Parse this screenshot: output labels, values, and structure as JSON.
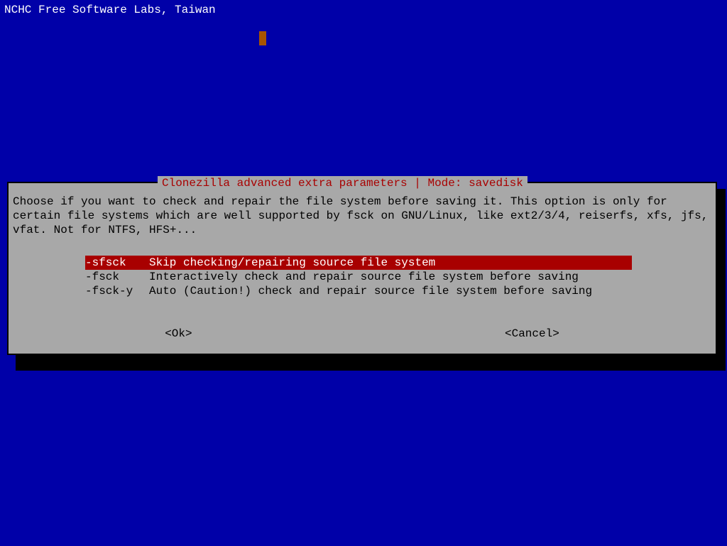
{
  "header": {
    "title": "NCHC Free Software Labs, Taiwan"
  },
  "dialog": {
    "title": "Clonezilla advanced extra parameters | Mode: savedisk",
    "description": "Choose if you want to check and repair the file system before saving it. This option is only for certain file systems which are well supported by fsck on GNU/Linux, like ext2/3/4, reiserfs, xfs, jfs, vfat. Not for NTFS, HFS+...",
    "options": [
      {
        "flag": "-sfsck",
        "desc": "Skip checking/repairing source file system",
        "selected": true
      },
      {
        "flag": "-fsck",
        "desc": "Interactively check and repair source file system before saving",
        "selected": false
      },
      {
        "flag": "-fsck-y",
        "desc": "Auto (Caution!) check and repair source file system before saving",
        "selected": false
      }
    ],
    "buttons": {
      "ok": "<Ok>",
      "cancel": "<Cancel>"
    }
  }
}
